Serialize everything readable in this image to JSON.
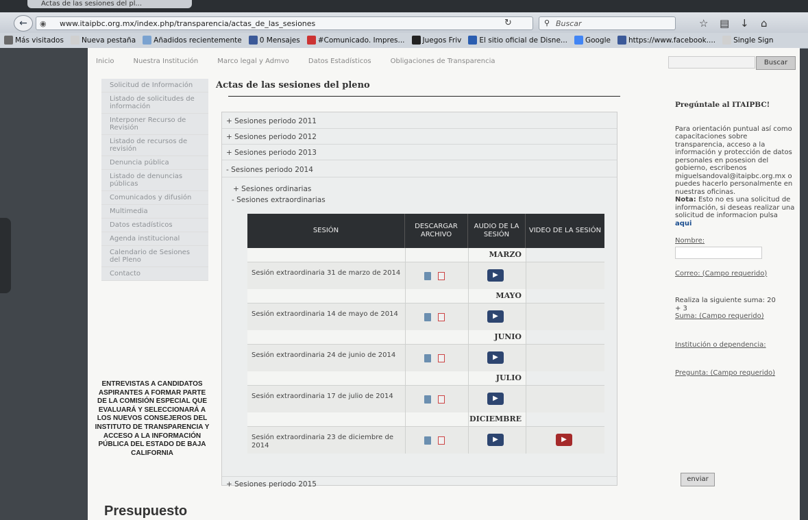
{
  "browser": {
    "tab_title": "Actas de las sesiones del pl...",
    "url": "www.itaipbc.org.mx/index.php/transparencia/actas_de_las_sesiones",
    "search_placeholder": "Buscar",
    "bookmarks": [
      {
        "label": "Más visitados",
        "icon_color": "#6a6a6a"
      },
      {
        "label": "Nueva pestaña",
        "icon_color": "#d0d0d0"
      },
      {
        "label": "Añadidos recientemente",
        "icon_color": "#7aa2d0"
      },
      {
        "label": "0 Mensajes",
        "icon_color": "#3b5998"
      },
      {
        "label": "#Comunicado. Impres...",
        "icon_color": "#cc3333"
      },
      {
        "label": "Juegos Friv",
        "icon_color": "#222222"
      },
      {
        "label": "El sitio oficial de Disne...",
        "icon_color": "#2a5db0"
      },
      {
        "label": "Google",
        "icon_color": "#4285f4"
      },
      {
        "label": "https://www.facebook....",
        "icon_color": "#3b5998"
      },
      {
        "label": "Single Sign",
        "icon_color": "#d0d0d0"
      }
    ]
  },
  "site": {
    "topnav": [
      "Inicio",
      "Nuestra Institución",
      "Marco legal y Admvo",
      "Datos Estadísticos",
      "Obligaciones de Transparencia"
    ],
    "search_button": "Buscar",
    "sidebar": [
      "Solicitud de Información",
      "Listado de solicitudes de información",
      "Interponer Recurso de Revisión",
      "Listado de recursos de revisión",
      "Denuncia pública",
      "Listado de denuncias públicas",
      "Comunicados y difusión",
      "Multimedia",
      "Datos estadísticos",
      "Agenda institucional",
      "Calendario de Sesiones del Pleno",
      "Contacto"
    ],
    "promo": "ENTREVISTAS A CANDIDATOS ASPIRANTES A FORMAR PARTE DE LA COMISIÓN ESPECIAL QUE EVALUARÁ Y SELECCIONARÁ A LOS NUEVOS CONSEJEROS DEL INSTITUTO DE TRANSPARENCIA Y ACCESO A LA INFORMACIÓN PÚBLICA DEL ESTADO DE BAJA CALIFORNIA",
    "presupuesto": "Presupuesto"
  },
  "content": {
    "title": "Actas de las sesiones del pleno",
    "periods": {
      "p2011": "+ Sesiones periodo 2011",
      "p2012": "+ Sesiones periodo 2012",
      "p2013": "+ Sesiones periodo 2013",
      "p2014": "- Sesiones periodo 2014",
      "p2015": "+ Sesiones periodo 2015"
    },
    "sub": {
      "ordinarias": "+ Sesiones ordinarias",
      "extraordinarias": "- Sesiones extraordinarias"
    },
    "table": {
      "headers": [
        "SESIÓN",
        "DESCARGAR ARCHIVO",
        "AUDIO DE LA SESIÓN",
        "VIDEO DE LA SESIÓN"
      ],
      "groups": [
        {
          "month": "MARZO",
          "session": "Sesión extraordinaria 31 de marzo de 2014",
          "video": false
        },
        {
          "month": "MAYO",
          "session": "Sesión extraordinaria 14 de mayo de 2014",
          "video": false
        },
        {
          "month": "JUNIO",
          "session": "Sesión extraordinaria 24 de junio de 2014",
          "video": false
        },
        {
          "month": "JULIO",
          "session": "Sesión extraordinaria 17 de julio de 2014",
          "video": false
        },
        {
          "month": "DICIEMBRE",
          "session": "Sesión extraordinaria 23 de diciembre de 2014",
          "video": true
        }
      ]
    }
  },
  "right": {
    "title": "Pregúntale al ITAIPBC!",
    "text": "Para orientación puntual así como capacitaciones sobre transparencia, acceso a la información y protección de datos personales en posesion del gobierno, escribenos miguelsandoval@itaipbc.org.mx o puedes hacerlo personalmente en nuestras oficinas.",
    "nota_label": "Nota:",
    "nota_text": "Esto no es una solicitud de información, si deseas realizar una solicitud de informacion pulsa",
    "aqui": "aqui",
    "nombre": "Nombre:",
    "correo": "Correo: (Campo requerido)",
    "suma_prompt": "Realiza la siguiente suma: 20 + 3",
    "suma": "Suma: (Campo requerido)",
    "institucion": "Institución o dependencia:",
    "pregunta": "Pregunta: (Campo requerido)",
    "enviar": "enviar"
  }
}
